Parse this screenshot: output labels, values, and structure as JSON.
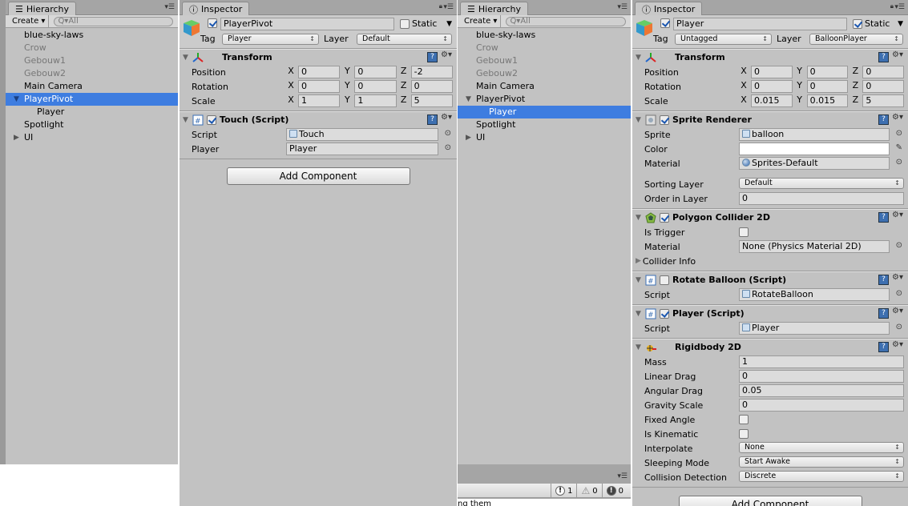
{
  "hierarchy_left": {
    "tab": "Hierarchy",
    "create": "Create",
    "search_placeholder": "All",
    "items": [
      {
        "label": "blue-sky-laws",
        "dim": false,
        "child": false,
        "selected": false,
        "foldout": ""
      },
      {
        "label": "Crow",
        "dim": true,
        "child": false,
        "selected": false,
        "foldout": ""
      },
      {
        "label": "Gebouw1",
        "dim": true,
        "child": false,
        "selected": false,
        "foldout": ""
      },
      {
        "label": "Gebouw2",
        "dim": true,
        "child": false,
        "selected": false,
        "foldout": ""
      },
      {
        "label": "Main Camera",
        "dim": false,
        "child": false,
        "selected": false,
        "foldout": ""
      },
      {
        "label": "PlayerPivot",
        "dim": false,
        "child": false,
        "selected": true,
        "foldout": "open"
      },
      {
        "label": "Player",
        "dim": false,
        "child": true,
        "selected": false,
        "foldout": ""
      },
      {
        "label": "Spotlight",
        "dim": false,
        "child": false,
        "selected": false,
        "foldout": ""
      },
      {
        "label": "UI",
        "dim": false,
        "child": false,
        "selected": false,
        "foldout": "closed"
      }
    ]
  },
  "hierarchy_right": {
    "tab": "Hierarchy",
    "create": "Create",
    "search_placeholder": "All",
    "items": [
      {
        "label": "blue-sky-laws",
        "dim": false,
        "child": false,
        "selected": false,
        "foldout": ""
      },
      {
        "label": "Crow",
        "dim": true,
        "child": false,
        "selected": false,
        "foldout": ""
      },
      {
        "label": "Gebouw1",
        "dim": true,
        "child": false,
        "selected": false,
        "foldout": ""
      },
      {
        "label": "Gebouw2",
        "dim": true,
        "child": false,
        "selected": false,
        "foldout": ""
      },
      {
        "label": "Main Camera",
        "dim": false,
        "child": false,
        "selected": false,
        "foldout": ""
      },
      {
        "label": "PlayerPivot",
        "dim": false,
        "child": false,
        "selected": false,
        "foldout": "open"
      },
      {
        "label": "Player",
        "dim": false,
        "child": true,
        "selected": true,
        "foldout": ""
      },
      {
        "label": "Spotlight",
        "dim": false,
        "child": false,
        "selected": false,
        "foldout": ""
      },
      {
        "label": "UI",
        "dim": false,
        "child": false,
        "selected": false,
        "foldout": "closed"
      }
    ],
    "console": {
      "info_count": "1",
      "warning_count": "0",
      "error_count": "0",
      "text": "ng them"
    }
  },
  "inspector_left": {
    "tab": "Inspector",
    "active": true,
    "name": "PlayerPivot",
    "static_label": "Static",
    "static": false,
    "tag_label": "Tag",
    "tag": "Player",
    "layer_label": "Layer",
    "layer": "Default",
    "components": [
      {
        "id": "transform",
        "title": "Transform",
        "icon": "transform-icon",
        "toggle": null,
        "rows": [
          {
            "label": "Position",
            "type": "vector3",
            "x": "0",
            "y": "0",
            "z": "-2"
          },
          {
            "label": "Rotation",
            "type": "vector3",
            "x": "0",
            "y": "0",
            "z": "0"
          },
          {
            "label": "Scale",
            "type": "vector3",
            "x": "1",
            "y": "1",
            "z": "5"
          }
        ]
      },
      {
        "id": "touch-script",
        "title": "Touch (Script)",
        "icon": "script-icon",
        "toggle": true,
        "rows": [
          {
            "label": "Script",
            "type": "object",
            "value": "Touch",
            "icon": "script"
          },
          {
            "label": "Player",
            "type": "object",
            "value": "Player",
            "icon": ""
          }
        ]
      }
    ],
    "add_component": "Add Component"
  },
  "inspector_right": {
    "tab": "Inspector",
    "active": true,
    "name": "Player",
    "static_label": "Static",
    "static": true,
    "tag_label": "Tag",
    "tag": "Untagged",
    "layer_label": "Layer",
    "layer": "BalloonPlayer",
    "components": [
      {
        "id": "transform",
        "title": "Transform",
        "icon": "transform-icon",
        "toggle": null,
        "rows": [
          {
            "label": "Position",
            "type": "vector3",
            "x": "0",
            "y": "0",
            "z": "0"
          },
          {
            "label": "Rotation",
            "type": "vector3",
            "x": "0",
            "y": "0",
            "z": "0"
          },
          {
            "label": "Scale",
            "type": "vector3",
            "x": "0.015",
            "y": "0.015",
            "z": "5"
          }
        ]
      },
      {
        "id": "sprite-renderer",
        "title": "Sprite Renderer",
        "icon": "sprite-renderer-icon",
        "toggle": true,
        "rows": [
          {
            "label": "Sprite",
            "type": "object",
            "value": "balloon",
            "icon": "sprite"
          },
          {
            "label": "Color",
            "type": "color",
            "value": "#ffffff"
          },
          {
            "label": "Material",
            "type": "object",
            "value": "Sprites-Default",
            "icon": "material"
          },
          {
            "label": "Sorting Layer",
            "type": "popup",
            "value": "Default"
          },
          {
            "label": "Order in Layer",
            "type": "text",
            "value": "0"
          }
        ]
      },
      {
        "id": "polygon-collider-2d",
        "title": "Polygon Collider 2D",
        "icon": "polygon-collider-icon",
        "toggle": true,
        "rows": [
          {
            "label": "Is Trigger",
            "type": "checkbox",
            "value": false
          },
          {
            "label": "Material",
            "type": "object",
            "value": "None (Physics Material 2D)",
            "icon": ""
          },
          {
            "label": "Collider Info",
            "type": "foldout"
          }
        ]
      },
      {
        "id": "rotate-balloon-script",
        "title": "Rotate Balloon (Script)",
        "icon": "script-icon",
        "toggle": false,
        "rows": [
          {
            "label": "Script",
            "type": "object",
            "value": "RotateBalloon",
            "icon": "script"
          }
        ]
      },
      {
        "id": "player-script",
        "title": "Player (Script)",
        "icon": "script-icon",
        "toggle": true,
        "rows": [
          {
            "label": "Script",
            "type": "object",
            "value": "Player",
            "icon": "script"
          }
        ]
      },
      {
        "id": "rigidbody-2d",
        "title": "Rigidbody 2D",
        "icon": "rigidbody-icon",
        "toggle": null,
        "rows": [
          {
            "label": "Mass",
            "type": "text",
            "value": "1"
          },
          {
            "label": "Linear Drag",
            "type": "text",
            "value": "0"
          },
          {
            "label": "Angular Drag",
            "type": "text",
            "value": "0.05"
          },
          {
            "label": "Gravity Scale",
            "type": "text",
            "value": "0"
          },
          {
            "label": "Fixed Angle",
            "type": "checkbox",
            "value": false
          },
          {
            "label": "Is Kinematic",
            "type": "checkbox",
            "value": false
          },
          {
            "label": "Interpolate",
            "type": "popup",
            "value": "None"
          },
          {
            "label": "Sleeping Mode",
            "type": "popup",
            "value": "Start Awake"
          },
          {
            "label": "Collision Detection",
            "type": "popup",
            "value": "Discrete"
          }
        ]
      }
    ],
    "add_component": "Add Component"
  }
}
